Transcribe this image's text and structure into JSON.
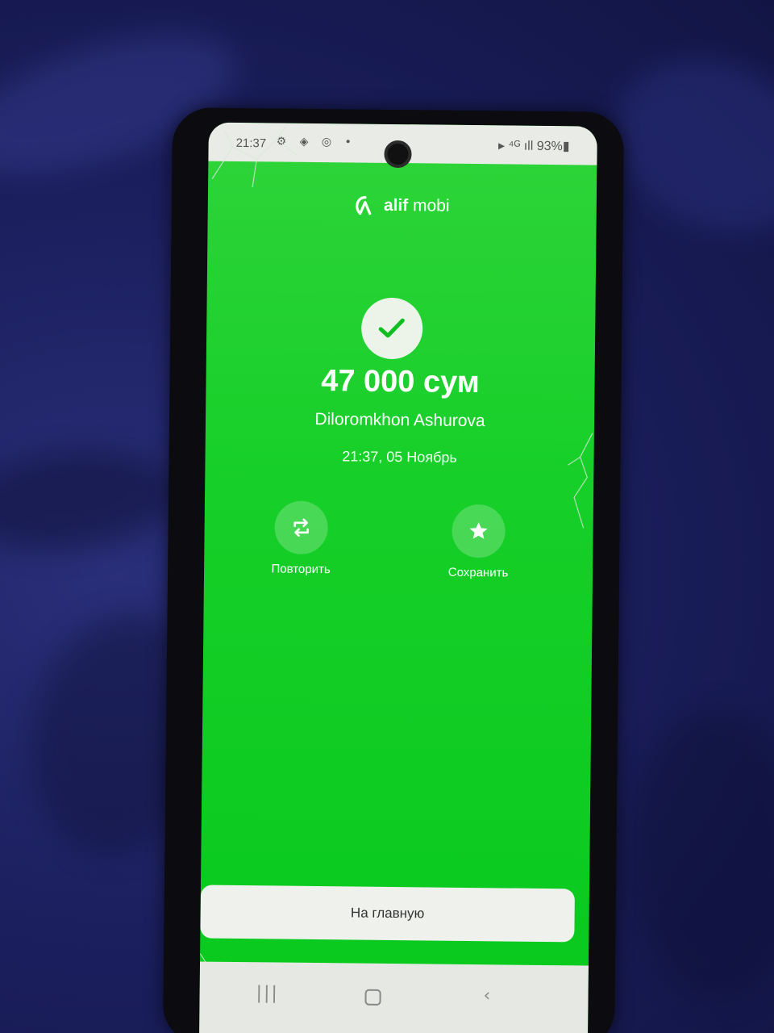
{
  "status_bar": {
    "time": "21:37",
    "left_icons": "⚙ ◈ ◎ •",
    "right_text": "▸ ⁴ᴳ ıll 93%▮"
  },
  "app": {
    "logo_main": "alif",
    "logo_sub": " mobi"
  },
  "payment": {
    "amount": "47 000 сум",
    "recipient": "Diloromkhon Ashurova",
    "datetime": "21:37, 05 Ноябрь"
  },
  "actions": {
    "repeat_label": "Повторить",
    "save_label": "Сохранить"
  },
  "home_button_label": "На главную",
  "navbar": {
    "recents": "|||",
    "back": "‹"
  },
  "colors": {
    "screen_green": "#16cf28",
    "background_fabric": "#1b1f5e"
  }
}
